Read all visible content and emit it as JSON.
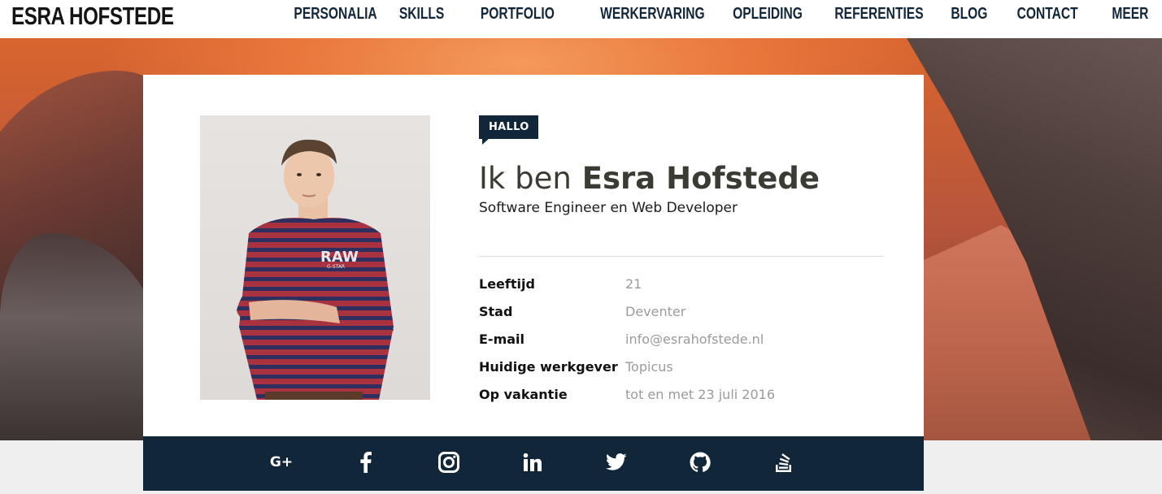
{
  "brand": "ESRA HOFSTEDE",
  "nav": [
    {
      "label": "PERSONALIA",
      "key": "personalia"
    },
    {
      "label": "SKILLS",
      "key": "skills"
    },
    {
      "label": "PORTFOLIO",
      "key": "portfolio"
    },
    {
      "label": "WERKERVARING",
      "key": "werkervaring"
    },
    {
      "label": "OPLEIDING",
      "key": "opleiding"
    },
    {
      "label": "REFERENTIES",
      "key": "referenties"
    },
    {
      "label": "BLOG",
      "key": "blog"
    },
    {
      "label": "CONTACT",
      "key": "contact"
    },
    {
      "label": "MEER",
      "key": "meer"
    }
  ],
  "profile": {
    "badge": "HALLO",
    "intro": "Ik ben",
    "name": "Esra Hofstede",
    "subtitle": "Software Engineer en Web Developer",
    "photo_shirt_text": "RAW",
    "photo_shirt_subtext": "G-STAR",
    "details": [
      {
        "label": "Leeftijd",
        "value": "21"
      },
      {
        "label": "Stad",
        "value": "Deventer"
      },
      {
        "label": "E-mail",
        "value": "info@esrahofstede.nl"
      },
      {
        "label": "Huidige werkgever",
        "value": "Topicus"
      },
      {
        "label": "Op vakantie",
        "value": "tot en met 23 juli 2016"
      }
    ]
  },
  "social": {
    "google_plus": "G+",
    "icons": [
      "google-plus-icon",
      "facebook-icon",
      "instagram-icon",
      "linkedin-icon",
      "twitter-icon",
      "github-icon",
      "stackoverflow-icon"
    ]
  },
  "colors": {
    "navy": "#12263a",
    "text_dark": "#3b3b33",
    "muted": "#9b9b9b"
  }
}
